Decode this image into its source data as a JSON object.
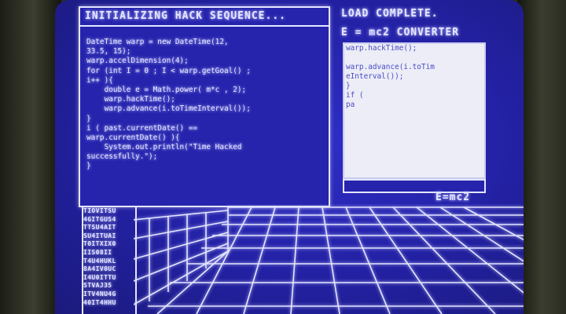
{
  "hack_panel": {
    "title": "INITIALIZING HACK SEQUENCE...",
    "code_lines": [
      "DateTime warp = new DateTime(12,",
      "33.5, 15);",
      "warp.accelDimension(4);",
      "for (int I = 0 ; I < warp.getGoal() ;",
      "i++ ){",
      "    double e = Math.power( m*c , 2);",
      "    warp.hackTime();",
      "    warp.advance(i.toTimeInterval());",
      "}",
      "i ( past.currentDate() ==",
      "warp.currentDate() ){",
      "    System.out.println(\"Time Hacked",
      "successfully.\");",
      "}"
    ]
  },
  "right_panel": {
    "load_status": "LOAD COMPLETE.",
    "converter_title": "E = mc2 CONVERTER",
    "output_lines": [
      "warp.hackTime();",
      "",
      "warp.advance(i.toTim",
      "eInterval());",
      "}",
      "if (",
      "pa"
    ],
    "input_value": "",
    "emc2_button": "E=mc2"
  },
  "char_column": [
    "TIOVITSU",
    "4GITGUS4",
    "TTSU4AIT",
    "SU4ITUAI",
    "T0ITXIX0",
    "IIS08II",
    "T4U4HUKL",
    "8A4IV0UC",
    "I4U0ITTU",
    "STVAJ35",
    "ITV4NU4G",
    "40IT4HHU"
  ],
  "colors": {
    "screen": "#2624ad",
    "phosphor": "#e4e6ff",
    "output_bg": "#ecedf6",
    "output_text": "#4b4ac8"
  }
}
